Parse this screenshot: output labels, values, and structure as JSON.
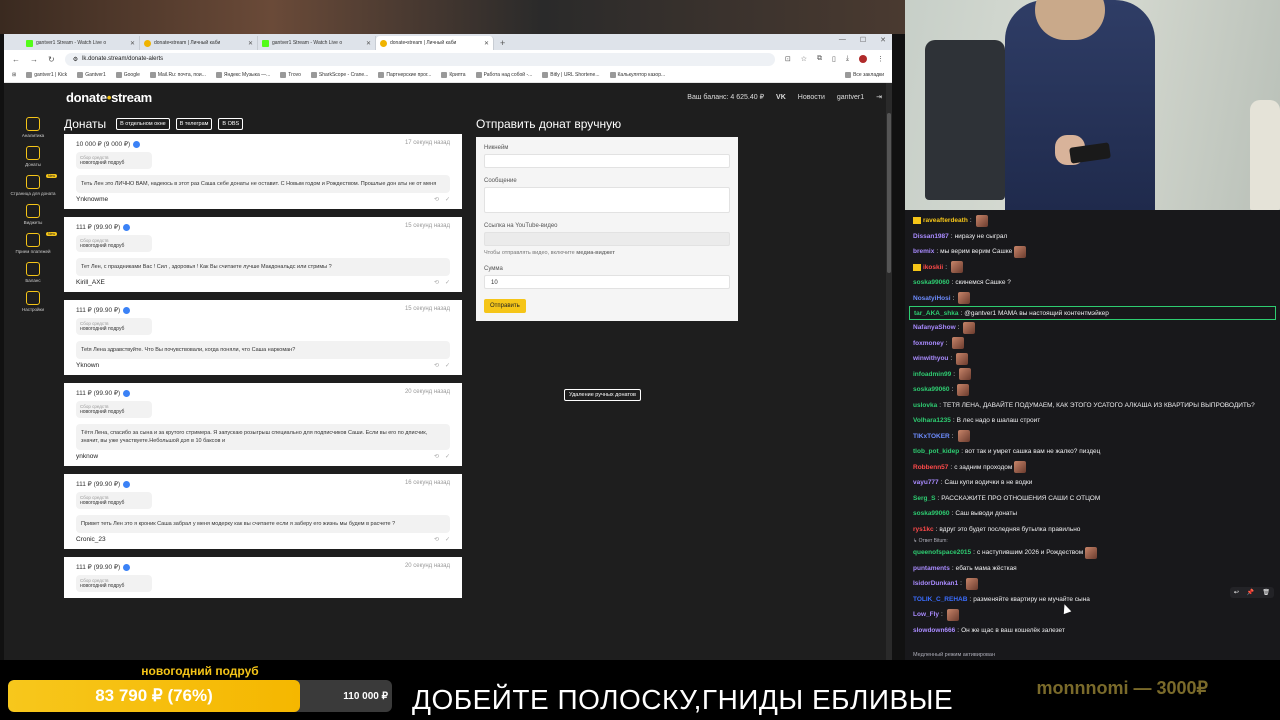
{
  "browser": {
    "tabs": [
      {
        "label": "gantver1 Stream - Watch Live o",
        "fav": "kick",
        "active": false
      },
      {
        "label": "donate•stream | Личный каби",
        "fav": "donate",
        "active": false
      },
      {
        "label": "gantver1 Stream - Watch Live o",
        "fav": "kick",
        "active": false
      },
      {
        "label": "donate•stream | Личный каби",
        "fav": "donate",
        "active": true
      }
    ],
    "new_tab": "+",
    "url": "lk.donate.stream/donate-alerts",
    "bookmarks": [
      "gantver1 | Kick",
      "Gantver1",
      "Google",
      "Mail.Ru: почта, пои...",
      "Яндекс Музыка —...",
      "Trovo",
      "SharkScope - Crane...",
      "Партнерские прог...",
      "Крипта",
      "Работа над собой -...",
      "Bitly | URL Shortene...",
      "Калькулятор казор..."
    ],
    "bookmarks_more": "Все закладки"
  },
  "app": {
    "logo_a": "donate",
    "logo_b": "stream",
    "balance": "Ваш баланс: 4 625.40 ₽",
    "vk": "VK",
    "news": "Новости",
    "user": "gantver1",
    "sidebar": [
      {
        "label": "Аналитика",
        "icon": "analytics-icon"
      },
      {
        "label": "Донаты",
        "icon": "donations-icon"
      },
      {
        "label": "Страница для доната",
        "icon": "donation-page-icon",
        "badge": "New"
      },
      {
        "label": "Виджеты",
        "icon": "widgets-icon"
      },
      {
        "label": "Прием платежей",
        "icon": "payments-icon",
        "badge": "New"
      },
      {
        "label": "Баланс",
        "icon": "balance-icon"
      },
      {
        "label": "Настройки",
        "icon": "settings-icon"
      }
    ],
    "donations_title": "Донаты",
    "pills": [
      "В отдельном окне",
      "В телеграм",
      "В OBS"
    ],
    "goal_label": "Сбор средств",
    "donations": [
      {
        "amount": "10 000 ₽ (9 000 ₽)",
        "time": "17 секунд назад",
        "goal": "новогодний подруб",
        "message": "Теть Лен это ЛИЧНО ВАМ, надеюсь в этот раз Саша себе донаты не оставит. С Новым годом и Рождеством. Прошлые дон аты не от меня",
        "user": "Ynknowme"
      },
      {
        "amount": "111 ₽ (99.90 ₽)",
        "time": "15 секунд назад",
        "goal": "новогодний подруб",
        "message": "Тет Лен, с праздниками Вас ! Сил , здоровья ! Как Вы считаете лучше Макдональдс или стримы ?",
        "user": "Kirill_AXE"
      },
      {
        "amount": "111 ₽ (99.90 ₽)",
        "time": "15 секунд назад",
        "goal": "новогодний подруб",
        "message": "Теtя Лена здравствуйте. Что Вы почувствовали, когда поняли, что Саша наркоман?",
        "user": "Yknown"
      },
      {
        "amount": "111 ₽ (99.90 ₽)",
        "time": "20 секунд назад",
        "goal": "новогодний подруб",
        "message": "Тётя Лена, спасибо за сына и за крутого стримера. Я запускаю розыгрыш специально для подписчиков Саши. Если вы его по дписчик, значит, вы уже участвуете.Небольшой дэп в 10 баксов и",
        "user": "ynknow"
      },
      {
        "amount": "111 ₽ (99.90 ₽)",
        "time": "16 секунд назад",
        "goal": "новогодний подруб",
        "message": "Привет теть Лен это я кроник Саша забрал у меня модерку как вы считаете если я заберу его жизнь мы будем в расчете ?",
        "user": "Cronic_23"
      },
      {
        "amount": "111 ₽ (99.90 ₽)",
        "time": "20 секунд назад",
        "goal": "новогодний подруб",
        "message": "",
        "user": ""
      }
    ],
    "manual": {
      "title": "Отправить донат вручную",
      "nick_label": "Никнейм",
      "msg_label": "Сообщение",
      "yt_label": "Ссылка на YouTube-видео",
      "yt_hint_a": "Чтобы отправлять видео, включите ",
      "yt_hint_b": "медиа-виджет",
      "sum_label": "Сумма",
      "sum_value": "10",
      "send": "Отправить",
      "delete": "Удаление ручных донатов"
    }
  },
  "chat": {
    "messages": [
      {
        "user": "raveafterdeath",
        "color": "#f5c518",
        "text": "",
        "emote": true,
        "crown": true
      },
      {
        "user": "Dissan1987",
        "color": "#a98bff",
        "text": "ниразу не сыграл"
      },
      {
        "user": "bremix",
        "color": "#a98bff",
        "text": "мы верим верим Сашке",
        "emote": true
      },
      {
        "user": "ikoskii",
        "color": "#ff4a4a",
        "text": "",
        "emote": true,
        "crown": true
      },
      {
        "user": "soska99060",
        "color": "#2ecc71",
        "text": "скинемся Сашке ?"
      },
      {
        "user": "NosatyiHosi",
        "color": "#6d8cff",
        "text": "",
        "emote": true
      },
      {
        "user": "tar_AKA_shka",
        "color": "#2ecc71",
        "text": "@gantver1 МАМА вы настоящий контентмэйкер",
        "hl": true
      },
      {
        "user": "NafanyaShow",
        "color": "#a98bff",
        "text": "",
        "emote": true
      },
      {
        "user": "foxmoney",
        "color": "#a98bff",
        "text": "",
        "emote": true
      },
      {
        "user": "winwithyou",
        "color": "#a98bff",
        "text": "",
        "emote": true
      },
      {
        "user": "infoadmin99",
        "color": "#2ecc71",
        "text": "",
        "emote": true
      },
      {
        "user": "soska99060",
        "color": "#2ecc71",
        "text": "",
        "emote": true
      },
      {
        "user": "uslovka",
        "color": "#2ecc71",
        "text": "ТЕТЯ ЛЕНА, ДАВАЙТЕ ПОДУМАЕМ, КАК ЭТОГО УСАТОГО АЛКАША ИЗ КВАРТИРЫ ВЫПРОВОДИТЬ?"
      },
      {
        "user": "Volhara1235",
        "color": "#2ecc71",
        "text": "В лес надо в шалаш строит"
      },
      {
        "user": "TIKxTOKER",
        "color": "#6d8cff",
        "text": "",
        "emote": true
      },
      {
        "user": "tlob_pot_kidep",
        "color": "#2ecc71",
        "text": "вот так и умрет сашка вам не жалко? пиздец"
      },
      {
        "user": "Robbenn57",
        "color": "#ff4a4a",
        "text": "с задним проходом",
        "emote": true
      },
      {
        "user": "vayu777",
        "color": "#a98bff",
        "text": "Саш купи водички в не водки"
      },
      {
        "user": "Serg_S",
        "color": "#2ecc71",
        "text": "РАССКАЖИТЕ ПРО ОТНОШЕНИЯ САШИ С ОТЦОМ"
      },
      {
        "user": "soska99060",
        "color": "#2ecc71",
        "text": "Саш выводи донаты"
      },
      {
        "user": "rys1kc",
        "color": "#ff4a4a",
        "text": "вдруг это будет последняя бутылка правильно"
      },
      {
        "user": "queenofspace2015",
        "color": "#2ecc71",
        "text": "с наступившим 2026 и Рождеством",
        "emote": true,
        "reply": "↳ Ответ Bitum:"
      },
      {
        "user": "puntaments",
        "color": "#a98bff",
        "text": "ебать мама жёсткая"
      },
      {
        "user": "IsidorDunkan1",
        "color": "#a98bff",
        "text": "",
        "emote": true
      },
      {
        "user": "TOLIK_C_REHAB",
        "color": "#3b6dff",
        "text": "разменяйте квартиру не мучайте сына"
      },
      {
        "user": "Low_Fly",
        "color": "#a98bff",
        "text": "",
        "emote": true
      },
      {
        "user": "slowdown666",
        "color": "#a98bff",
        "text": "Он же щас в ваш кошелёк залезет"
      }
    ],
    "footer": "Медленный режим активирован"
  },
  "overlay": {
    "goal_title": "новогодний подруб",
    "goal_current": "83 790 ₽ (76%)",
    "goal_target": "110 000 ₽",
    "goal_fraction": 0.76,
    "ticker": "ДОБЕЙТЕ ПОЛОСКУ,ГНИДЫ ЕБЛИВЫЕ",
    "last_donation": "monnnomi — 3000₽"
  }
}
